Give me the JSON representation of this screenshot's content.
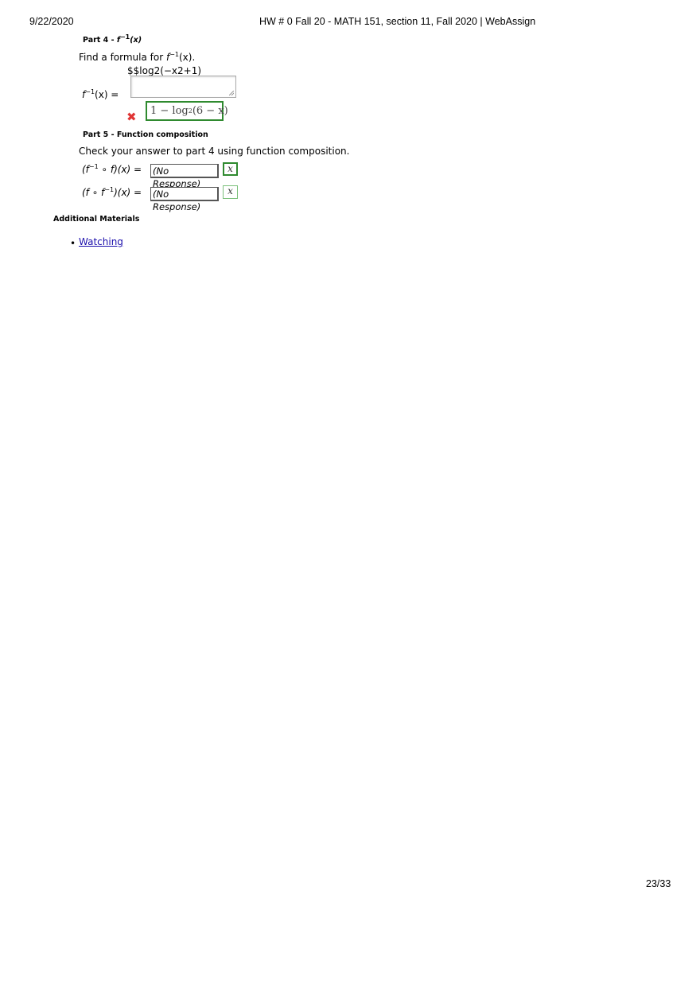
{
  "header": {
    "date": "9/22/2020",
    "title": "HW # 0 Fall 20 - MATH 151, section 11, Fall 2020 | WebAssign"
  },
  "part4": {
    "label_prefix": "Part 4 - ",
    "label_math_f": "f",
    "label_math_sup": "−1",
    "label_math_arg": "(x)",
    "prompt_prefix": "Find a formula for ",
    "prompt_f": "f",
    "prompt_sup": "−1",
    "prompt_arg": "(x).",
    "typed_answer": "$$log2(−x2+1)",
    "answer_label_f": "f",
    "answer_label_sup": "−1",
    "answer_label_rest": "(x)  =",
    "correct_answer_main": "1 − log",
    "correct_answer_sub": "2",
    "correct_answer_tail": "(6 − x)",
    "status_icon": "incorrect-x-icon",
    "status_color": "#e03535"
  },
  "part5": {
    "label": "Part 5 - Function composition",
    "prompt": "Check your answer to part 4 using function composition.",
    "row1": {
      "label_open": "(f",
      "label_sup": "−1",
      "label_rest": " ∘ f)(x)  =",
      "response": "(No Response)",
      "button": "x"
    },
    "row2": {
      "label_open": "(f ∘ f",
      "label_sup": "−1",
      "label_rest": ")(x)  =",
      "response": "(No Response)",
      "button": "x"
    }
  },
  "additional": {
    "heading": "Additional Materials",
    "link": "Watching"
  },
  "footer": {
    "page": "23/33"
  },
  "colors": {
    "correct_border": "#2f8a2f",
    "link": "#1a0dab"
  }
}
